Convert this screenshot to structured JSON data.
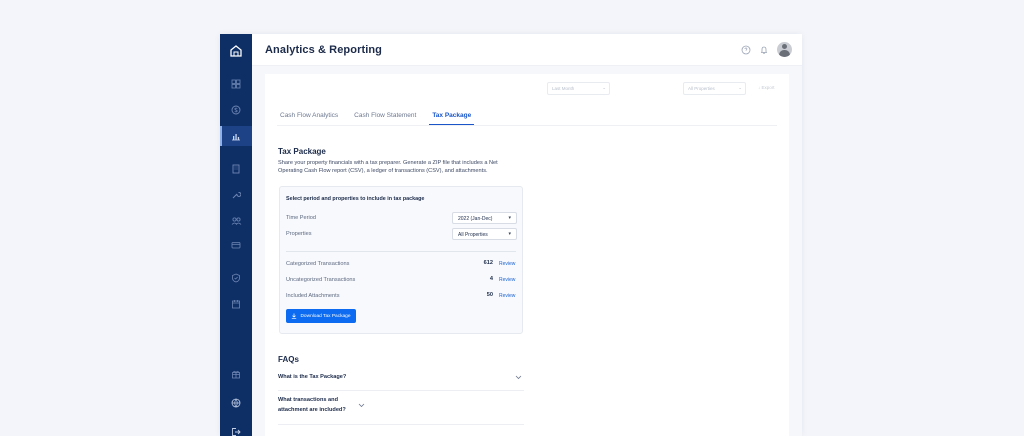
{
  "app": {
    "title": "Analytics & Reporting"
  },
  "colors": {
    "sidebar": "#0e2f66",
    "accent": "#1a56c9",
    "button": "#0c6bf0"
  },
  "sidebar": {
    "logo": "home-logo-icon",
    "items": [
      {
        "icon": "grid-icon"
      },
      {
        "icon": "dollar-circle-icon"
      },
      {
        "icon": "bar-chart-icon",
        "active": true
      },
      {
        "icon": "building-icon"
      },
      {
        "icon": "wrench-icon"
      },
      {
        "icon": "people-icon"
      },
      {
        "icon": "credit-card-icon"
      },
      {
        "icon": "shield-icon"
      },
      {
        "icon": "calendar-icon"
      },
      {
        "icon": "gift-icon"
      },
      {
        "icon": "globe-icon"
      },
      {
        "icon": "logout-icon"
      }
    ]
  },
  "header_icons": [
    "help-icon",
    "bell-icon",
    "avatar"
  ],
  "toolbar": {
    "period_placeholder": "Last Month",
    "properties_value": "All Properties",
    "export_label": "Export"
  },
  "tabs": [
    {
      "label": "Cash Flow Analytics"
    },
    {
      "label": "Cash Flow Statement"
    },
    {
      "label": "Tax Package",
      "active": true
    }
  ],
  "tax_package": {
    "title": "Tax Package",
    "description": "Share your property financials with a tax preparer. Generate a ZIP file that includes a Net Operating Cash Flow report (CSV), a ledger of transactions (CSV), and attachments.",
    "card_heading": "Select period and properties to include in tax package",
    "time_period_label": "Time Period",
    "time_period_value": "2022 (Jan-Dec)",
    "properties_label": "Properties",
    "properties_value": "All Properties",
    "stats": [
      {
        "label": "Categorized Transactions",
        "count": "612",
        "action": "Review"
      },
      {
        "label": "Uncategorized Transactions",
        "count": "4",
        "action": "Review"
      },
      {
        "label": "Included Attachments",
        "count": "50",
        "action": "Review"
      }
    ],
    "download_label": "Download Tax Package"
  },
  "faqs": {
    "title": "FAQs",
    "items": [
      {
        "question": "What is the Tax Package?"
      },
      {
        "question": "What transactions and attachment are included?"
      }
    ]
  }
}
